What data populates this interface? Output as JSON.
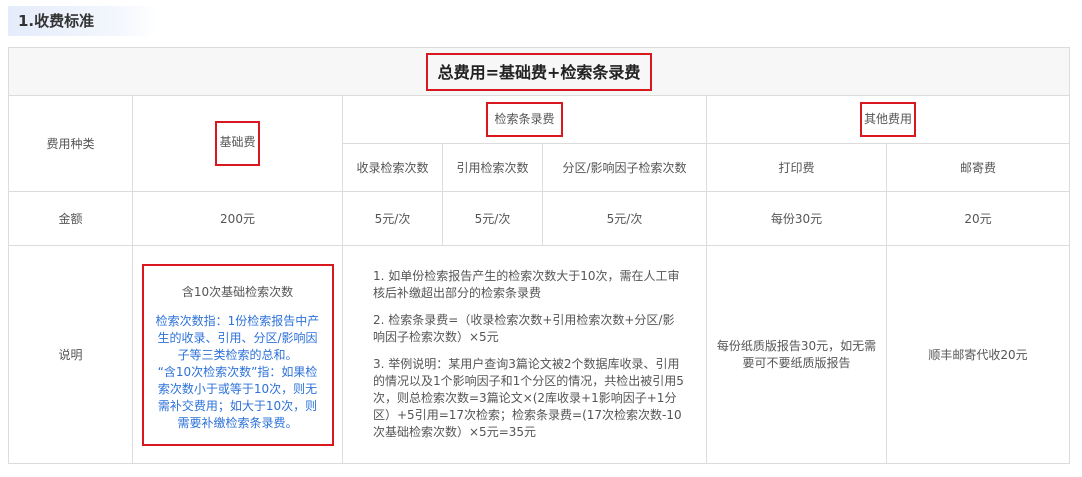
{
  "section": {
    "title": "1.收费标准"
  },
  "table": {
    "title": "总费用=基础费+检索条录费",
    "row_fee_type": "费用种类",
    "base_fee": "基础费",
    "search_fee": "检索条录费",
    "other_fee": "其他费用",
    "sub": {
      "record_count": "收录检索次数",
      "cite_count": "引用检索次数",
      "zone_count": "分区/影响因子检索次数",
      "print_fee": "打印费",
      "mail_fee": "邮寄费"
    },
    "row_amount": "金额",
    "amount": {
      "base": "200元",
      "record": "5元/次",
      "cite": "5元/次",
      "zone": "5元/次",
      "print": "每份30元",
      "mail": "20元"
    },
    "row_note": "说明",
    "note": {
      "base_title": "含10次基础检索次数",
      "base_detail1": "检索次数指：1份检索报告中产生的收录、引用、分区/影响因子等三类检索的总和。",
      "base_detail2": "“含10次检索次数”指：如果检索次数小于或等于10次，则无需补交费用；如大于10次，则需要补缴检索条录费。",
      "search_p1": "1. 如单份检索报告产生的检索次数大于10次，需在人工审核后补缴超出部分的检索条录费",
      "search_p2": "2. 检索条录费=（收录检索次数+引用检索次数+分区/影响因子检索次数）×5元",
      "search_p3": "3. 举例说明：某用户查询3篇论文被2个数据库收录、引用的情况以及1个影响因子和1个分区的情况，共检出被引用5次，则总检索次数=3篇论文×(2库收录+1影响因子+1分区）+5引用=17次检索；检索条录费=(17次检索次数-10次基础检索次数）×5元=35元",
      "print": "每份纸质版报告30元，如无需要可不要纸质版报告",
      "mail": "顺丰邮寄代收20元"
    }
  }
}
